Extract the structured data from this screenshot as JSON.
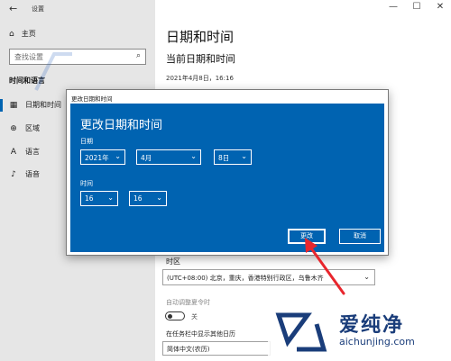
{
  "window": {
    "title": "设置",
    "back_glyph": "←",
    "minimize_glyph": "—",
    "maximize_glyph": "☐",
    "close_glyph": "✕"
  },
  "sidebar": {
    "home_label": "主页",
    "search_placeholder": "查找设置",
    "section_title": "时间和语言",
    "items": [
      {
        "label": "日期和时间",
        "icon": "calendar-icon",
        "active": true
      },
      {
        "label": "区域",
        "icon": "globe-icon"
      },
      {
        "label": "语言",
        "icon": "language-icon"
      },
      {
        "label": "语音",
        "icon": "microphone-icon"
      }
    ]
  },
  "main": {
    "title": "日期和时间",
    "current_heading": "当前日期和时间",
    "current_value": "2021年4月8日，16:16",
    "timezone_label": "时区",
    "timezone_value": "(UTC+08:00) 北京，重庆，香港特别行政区，乌鲁木齐",
    "dst_label": "自动调整夏令时",
    "dst_state": "关",
    "calendar_label": "在任务栏中显示其他日历",
    "calendar_value": "简体中文(农历)"
  },
  "dialog": {
    "title": "更改日期和时间",
    "heading": "更改日期和时间",
    "date_label": "日期",
    "year": "2021年",
    "month": "4月",
    "day": "8日",
    "time_label": "时间",
    "hour": "16",
    "minute": "16",
    "change_button": "更改",
    "cancel_button": "取消"
  },
  "watermark": {
    "brand": "爱纯净",
    "url": "aichunjing.com"
  },
  "colors": {
    "accent": "#0063b1",
    "annotation_arrow": "#e8262d"
  }
}
